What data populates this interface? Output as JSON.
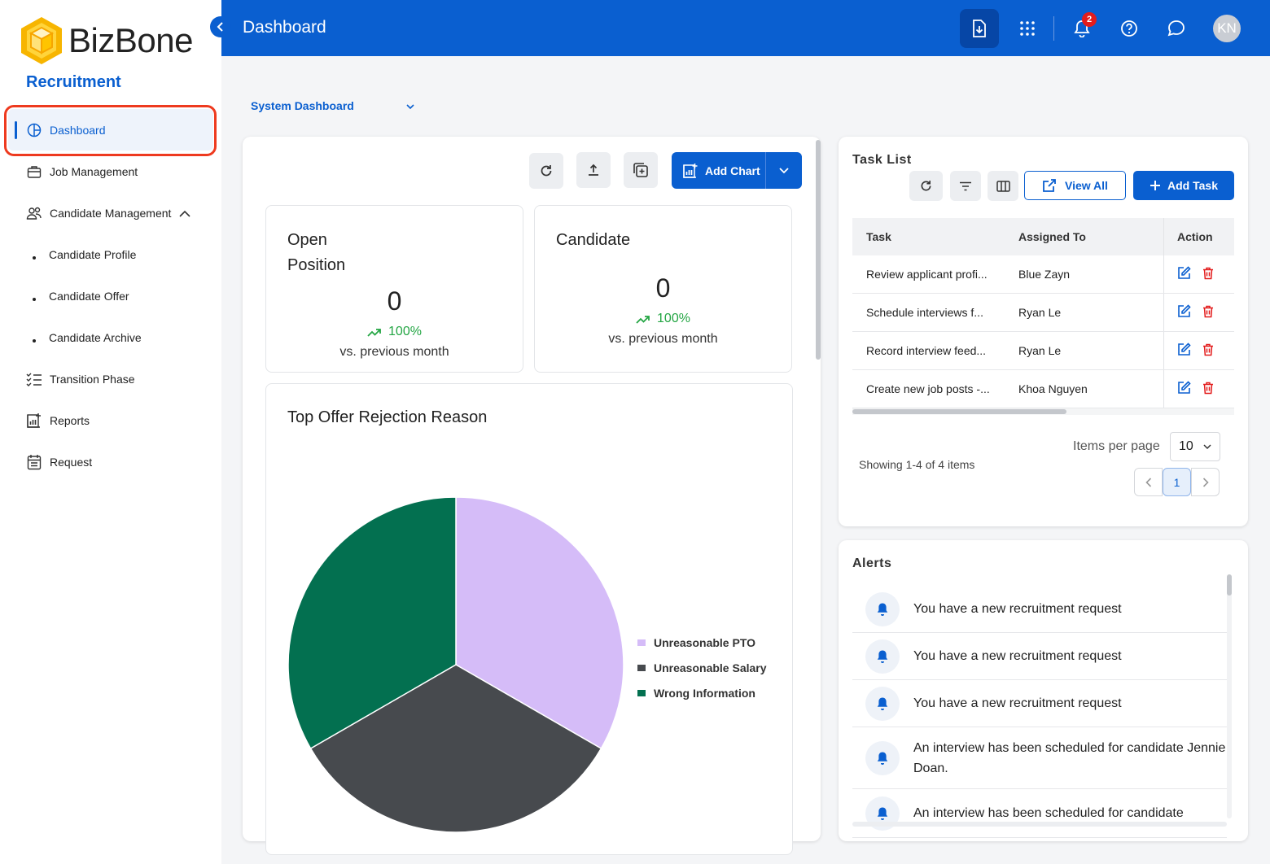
{
  "app": {
    "name": "BizBone",
    "module": "Recruitment"
  },
  "sidebar": {
    "items": [
      {
        "label": "Dashboard",
        "icon": "dashboard-icon",
        "active": true
      },
      {
        "label": "Job Management",
        "icon": "briefcase-icon"
      },
      {
        "label": "Candidate Management",
        "icon": "people-icon",
        "expanded": true
      },
      {
        "label": "Candidate Profile",
        "sub": true
      },
      {
        "label": "Candidate Offer",
        "sub": true
      },
      {
        "label": "Candidate Archive",
        "sub": true
      },
      {
        "label": "Transition Phase",
        "icon": "checklist-icon"
      },
      {
        "label": "Reports",
        "icon": "report-icon"
      },
      {
        "label": "Request",
        "icon": "request-icon"
      }
    ]
  },
  "topbar": {
    "title": "Dashboard",
    "notification_count": "2",
    "avatar_initials": "KN"
  },
  "dashboard_selector": {
    "value": "System Dashboard"
  },
  "toolbar": {
    "add_chart_label": "Add Chart"
  },
  "stats": [
    {
      "title_line1": "Open",
      "title_line2": "Position",
      "value": "0",
      "trend": "100%",
      "sub": "vs. previous month"
    },
    {
      "title_line1": "Candidate",
      "title_line2": "",
      "value": "0",
      "trend": "100%",
      "sub": "vs. previous month"
    }
  ],
  "chart_data": {
    "type": "pie",
    "title": "Top Offer Rejection Reason",
    "labels": [
      "Unreasonable PTO",
      "Unreasonable Salary",
      "Wrong Information"
    ],
    "values": [
      1,
      1,
      1
    ],
    "colors": [
      "#d5bcf8",
      "#474a4e",
      "#037050"
    ],
    "legend": "right"
  },
  "task_list": {
    "title": "Task List",
    "view_all_label": "View All",
    "add_task_label": "Add Task",
    "columns": [
      "Task",
      "Assigned To",
      "Action"
    ],
    "rows": [
      {
        "task": "Review applicant profi...",
        "assigned": "Blue Zayn"
      },
      {
        "task": "Schedule interviews f...",
        "assigned": "Ryan Le"
      },
      {
        "task": "Record interview feed...",
        "assigned": "Ryan Le"
      },
      {
        "task": "Create new job posts -...",
        "assigned": "Khoa Nguyen"
      }
    ],
    "showing": "Showing 1-4 of 4 items",
    "items_per_page_label": "Items per page",
    "items_per_page": "10",
    "current_page": "1"
  },
  "alerts": {
    "title": "Alerts",
    "items": [
      {
        "text": "You have a new recruitment request"
      },
      {
        "text": "You have a new recruitment request"
      },
      {
        "text": "You have a new recruitment request"
      },
      {
        "text": "An interview has been scheduled for candidate Jennie Doan."
      },
      {
        "text": "An interview has been scheduled for candidate"
      }
    ]
  },
  "colors": {
    "primary": "#0a5fd0",
    "trend_up": "#24a644",
    "delete": "#e31c1c",
    "highlight": "#ee3a1f"
  }
}
